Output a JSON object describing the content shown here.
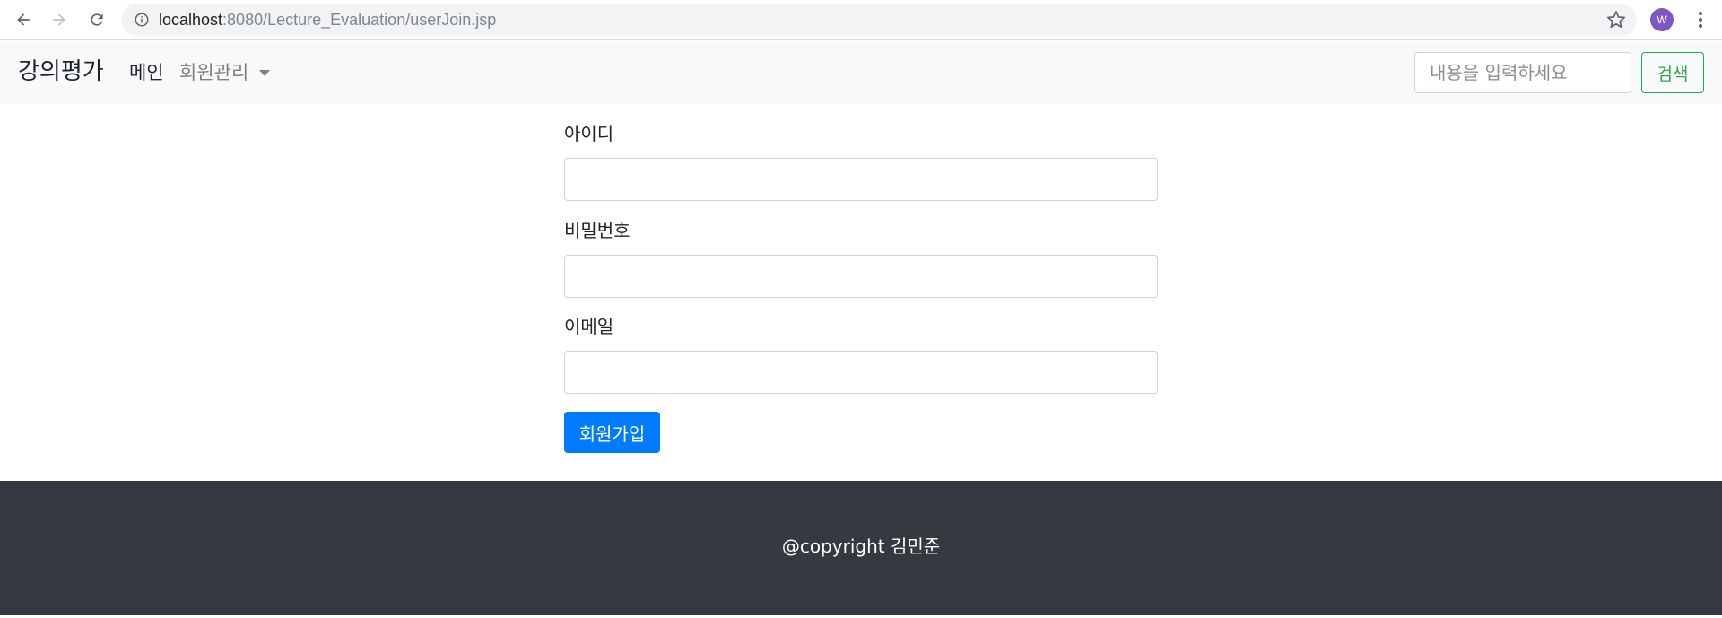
{
  "browser": {
    "url_host": "localhost",
    "url_path": ":8080/Lecture_Evaluation/userJoin.jsp",
    "profile_initial": "W"
  },
  "navbar": {
    "brand": "강의평가",
    "main_link": "메인",
    "dropdown_label": "회원관리",
    "search_placeholder": "내용을 입력하세요",
    "search_button": "검색"
  },
  "form": {
    "id_label": "아이디",
    "password_label": "비밀번호",
    "email_label": "이메일",
    "id_value": "",
    "password_value": "",
    "email_value": "",
    "submit_label": "회원가입"
  },
  "footer": {
    "copyright": "@copyright 김민준"
  },
  "colors": {
    "primary": "#007bff",
    "success": "#28a745",
    "footer_bg": "#343a40",
    "navbar_bg": "#f8f9fa"
  }
}
